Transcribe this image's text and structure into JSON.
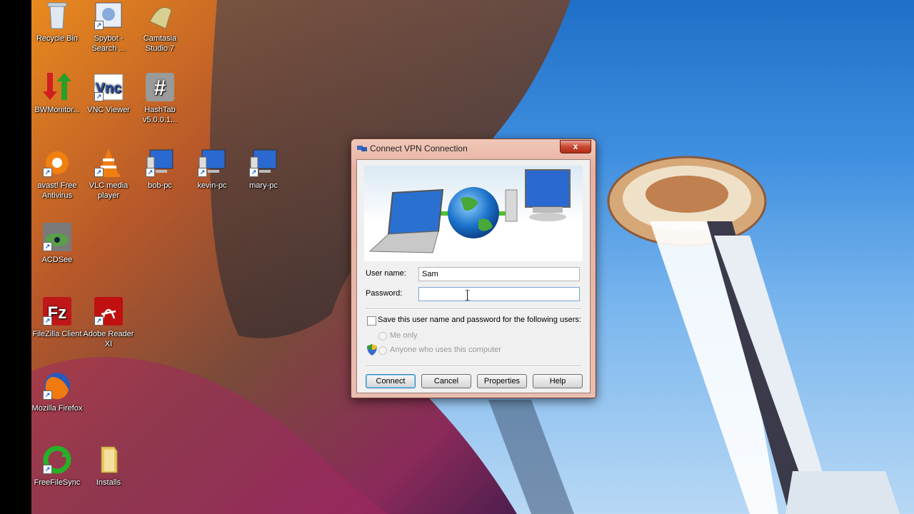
{
  "desktop": {
    "icons": [
      {
        "id": "recycle-bin",
        "label": "Recycle Bin",
        "icon": "recycle-bin-icon"
      },
      {
        "id": "spybot",
        "label": "Spybot - Search ...",
        "icon": "spybot-icon"
      },
      {
        "id": "camtasia",
        "label": "Camtasia Studio 7",
        "icon": "camtasia-icon"
      },
      {
        "id": "bwmonitor",
        "label": "BWMonitor...",
        "icon": "bandwidth-monitor-icon"
      },
      {
        "id": "vnc",
        "label": "VNC Viewer",
        "icon": "vnc-icon"
      },
      {
        "id": "hashtab",
        "label": "HashTab v5.0.0.1...",
        "icon": "hashtab-icon"
      },
      {
        "id": "avast",
        "label": "avast! Free Antivirus",
        "icon": "avast-icon"
      },
      {
        "id": "vlc",
        "label": "VLC media player",
        "icon": "vlc-icon"
      },
      {
        "id": "bob-pc",
        "label": "bob-pc",
        "icon": "computer-icon"
      },
      {
        "id": "kevin-pc",
        "label": "kevin-pc",
        "icon": "computer-icon"
      },
      {
        "id": "mary-pc",
        "label": "mary-pc",
        "icon": "computer-icon"
      },
      {
        "id": "acdsee",
        "label": "ACDSee",
        "icon": "acdsee-icon"
      },
      {
        "id": "filezilla",
        "label": "FileZilla Client",
        "icon": "filezilla-icon"
      },
      {
        "id": "adobe",
        "label": "Adobe Reader XI",
        "icon": "adobe-reader-icon"
      },
      {
        "id": "firefox",
        "label": "Mozilla Firefox",
        "icon": "firefox-icon"
      },
      {
        "id": "freefilesync",
        "label": "FreeFileSync",
        "icon": "freefilesync-icon"
      },
      {
        "id": "installs",
        "label": "Installs",
        "icon": "folder-icon"
      }
    ]
  },
  "dialog": {
    "title": "Connect VPN Connection",
    "close_label": "x",
    "username_label": "User name:",
    "username_value": "Sam",
    "password_label": "Password:",
    "password_value": "",
    "save_checkbox_label": "Save this user name and password for the following users:",
    "save_checked": false,
    "radio_me_only": "Me only",
    "radio_anyone": "Anyone who uses this computer",
    "buttons": {
      "connect": "Connect",
      "cancel": "Cancel",
      "properties": "Properties",
      "help": "Help"
    }
  },
  "colors": {
    "title_bar": "#e9bdb0",
    "close_button": "#c84830",
    "default_button_border": "#3c7fb1"
  }
}
